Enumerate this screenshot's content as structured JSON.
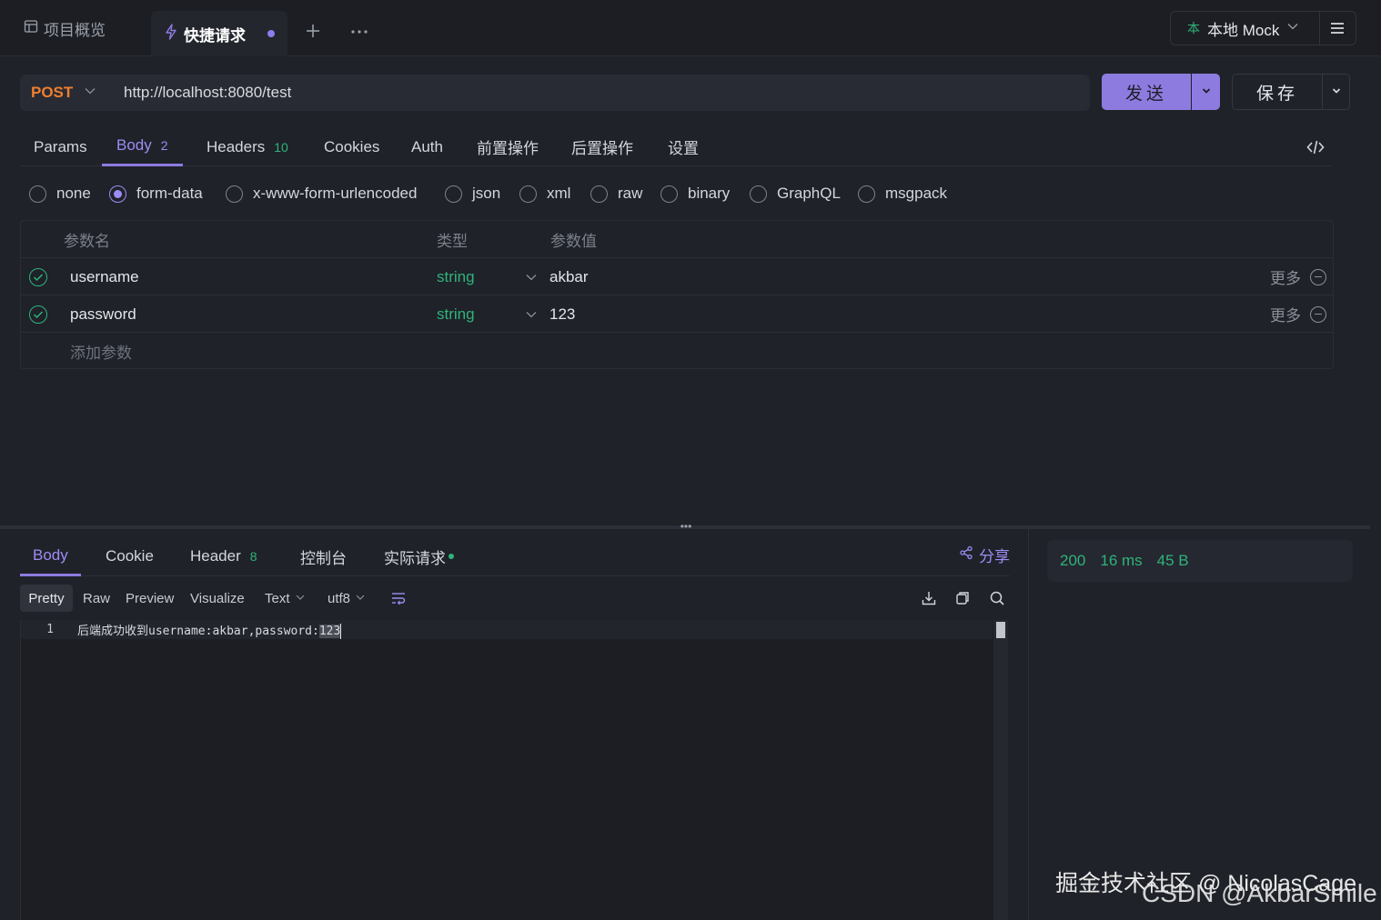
{
  "top_tabs": {
    "overview_label": "项目概览",
    "quick_request_label": "快捷请求",
    "mock_label": "本地 Mock"
  },
  "request": {
    "method": "POST",
    "url": "http://localhost:8080/test",
    "send_label": "发送",
    "save_label": "保存"
  },
  "request_tabs": [
    {
      "label": "Params",
      "count": ""
    },
    {
      "label": "Body",
      "count": "2"
    },
    {
      "label": "Headers",
      "count": "10"
    },
    {
      "label": "Cookies",
      "count": ""
    },
    {
      "label": "Auth",
      "count": ""
    },
    {
      "label": "前置操作",
      "count": ""
    },
    {
      "label": "后置操作",
      "count": ""
    },
    {
      "label": "设置",
      "count": ""
    }
  ],
  "active_request_tab": "Body",
  "body_types": [
    "none",
    "form-data",
    "x-www-form-urlencoded",
    "json",
    "xml",
    "raw",
    "binary",
    "GraphQL",
    "msgpack"
  ],
  "selected_body_type": "form-data",
  "params": {
    "headers": [
      "参数名",
      "类型",
      "参数值"
    ],
    "rows": [
      {
        "name": "username",
        "type": "string",
        "value": "akbar",
        "more": "更多"
      },
      {
        "name": "password",
        "type": "string",
        "value": "123",
        "more": "更多"
      }
    ],
    "add_placeholder": "添加参数"
  },
  "response_tabs": [
    {
      "label": "Body",
      "count": ""
    },
    {
      "label": "Cookie",
      "count": ""
    },
    {
      "label": "Header",
      "count": "8"
    },
    {
      "label": "控制台",
      "count": ""
    },
    {
      "label": "实际请求",
      "count": ""
    }
  ],
  "share_label": "分享",
  "format_options": [
    "Pretty",
    "Raw",
    "Preview",
    "Visualize"
  ],
  "text_select": "Text",
  "encoding_select": "utf8",
  "response_body": {
    "line_number": "1",
    "text_before": "后端成功收到username:akbar,password:",
    "text_highlight": "123"
  },
  "status": {
    "code": "200",
    "time": "16 ms",
    "size": "45 B"
  },
  "watermark": {
    "line1": "掘金技术社区 @ NicolasCage",
    "line2": "CSDN @AkbarSmile"
  },
  "colors": {
    "accent": "#8e7be0",
    "method_post": "#f17e2e",
    "success": "#2fb37a"
  }
}
